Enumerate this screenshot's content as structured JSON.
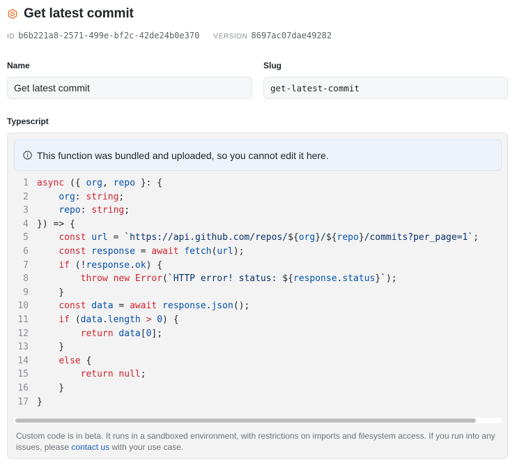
{
  "header": {
    "title": "Get latest commit",
    "icon": "function-icon",
    "accent": "#e8772e"
  },
  "meta": {
    "id_key": "ID",
    "id_value": "b6b221a8-2571-499e-bf2c-42de24b0e370",
    "version_key": "VERSION",
    "version_value": "8697ac07dae49282"
  },
  "form": {
    "name_label": "Name",
    "name_value": "Get latest commit",
    "slug_label": "Slug",
    "slug_value": "get-latest-commit",
    "typescript_label": "Typescript"
  },
  "banner": {
    "icon": "info-icon",
    "text": "This function was bundled and uploaded, so you cannot edit it here."
  },
  "code_lines": [
    {
      "n": "1",
      "tokens": [
        [
          "kw",
          "async"
        ],
        [
          "pun",
          " ({ "
        ],
        [
          "id",
          "org"
        ],
        [
          "pun",
          ", "
        ],
        [
          "id",
          "repo"
        ],
        [
          "pun",
          " }: {"
        ]
      ]
    },
    {
      "n": "2",
      "tokens": [
        [
          "pun",
          "    "
        ],
        [
          "id",
          "org"
        ],
        [
          "pun",
          ": "
        ],
        [
          "kw",
          "string"
        ],
        [
          "pun",
          ";"
        ]
      ]
    },
    {
      "n": "3",
      "tokens": [
        [
          "pun",
          "    "
        ],
        [
          "id",
          "repo"
        ],
        [
          "pun",
          ": "
        ],
        [
          "kw",
          "string"
        ],
        [
          "pun",
          ";"
        ]
      ]
    },
    {
      "n": "4",
      "tokens": [
        [
          "pun",
          "}) => {"
        ]
      ]
    },
    {
      "n": "5",
      "tokens": [
        [
          "pun",
          "    "
        ],
        [
          "kw",
          "const"
        ],
        [
          "pun",
          " "
        ],
        [
          "id",
          "url"
        ],
        [
          "pun",
          " = "
        ],
        [
          "str",
          "`https://api.github.com/repos/"
        ],
        [
          "pun",
          "${"
        ],
        [
          "id",
          "org"
        ],
        [
          "pun",
          "}"
        ],
        [
          "str",
          "/"
        ],
        [
          "pun",
          "${"
        ],
        [
          "id",
          "repo"
        ],
        [
          "pun",
          "}"
        ],
        [
          "str",
          "/commits?per_page=1`"
        ],
        [
          "pun",
          ";"
        ]
      ]
    },
    {
      "n": "6",
      "tokens": [
        [
          "pun",
          "    "
        ],
        [
          "kw",
          "const"
        ],
        [
          "pun",
          " "
        ],
        [
          "id",
          "response"
        ],
        [
          "pun",
          " = "
        ],
        [
          "kw",
          "await"
        ],
        [
          "pun",
          " "
        ],
        [
          "id",
          "fetch"
        ],
        [
          "pun",
          "("
        ],
        [
          "id",
          "url"
        ],
        [
          "pun",
          ");"
        ]
      ]
    },
    {
      "n": "7",
      "tokens": [
        [
          "pun",
          "    "
        ],
        [
          "kw",
          "if"
        ],
        [
          "pun",
          " (!"
        ],
        [
          "id",
          "response"
        ],
        [
          "pun",
          "."
        ],
        [
          "id",
          "ok"
        ],
        [
          "pun",
          ") {"
        ]
      ]
    },
    {
      "n": "8",
      "tokens": [
        [
          "pun",
          "        "
        ],
        [
          "kw",
          "throw"
        ],
        [
          "pun",
          " "
        ],
        [
          "kw",
          "new"
        ],
        [
          "pun",
          " "
        ],
        [
          "kw",
          "Error"
        ],
        [
          "pun",
          "("
        ],
        [
          "str",
          "`HTTP error! status: "
        ],
        [
          "pun",
          "${"
        ],
        [
          "id",
          "response"
        ],
        [
          "pun",
          "."
        ],
        [
          "id",
          "status"
        ],
        [
          "pun",
          "}"
        ],
        [
          "str",
          "`"
        ],
        [
          "pun",
          ");"
        ]
      ]
    },
    {
      "n": "9",
      "tokens": [
        [
          "pun",
          "    }"
        ]
      ]
    },
    {
      "n": "10",
      "tokens": [
        [
          "pun",
          "    "
        ],
        [
          "kw",
          "const"
        ],
        [
          "pun",
          " "
        ],
        [
          "id",
          "data"
        ],
        [
          "pun",
          " = "
        ],
        [
          "kw",
          "await"
        ],
        [
          "pun",
          " "
        ],
        [
          "id",
          "response"
        ],
        [
          "pun",
          "."
        ],
        [
          "id",
          "json"
        ],
        [
          "pun",
          "();"
        ]
      ]
    },
    {
      "n": "11",
      "tokens": [
        [
          "pun",
          "    "
        ],
        [
          "kw",
          "if"
        ],
        [
          "pun",
          " ("
        ],
        [
          "id",
          "data"
        ],
        [
          "pun",
          "."
        ],
        [
          "id",
          "length"
        ],
        [
          "pun",
          " "
        ],
        [
          "kw",
          ">"
        ],
        [
          "pun",
          " "
        ],
        [
          "num",
          "0"
        ],
        [
          "pun",
          ") {"
        ]
      ]
    },
    {
      "n": "12",
      "tokens": [
        [
          "pun",
          "        "
        ],
        [
          "kw",
          "return"
        ],
        [
          "pun",
          " "
        ],
        [
          "id",
          "data"
        ],
        [
          "pun",
          "["
        ],
        [
          "num",
          "0"
        ],
        [
          "pun",
          "];"
        ]
      ]
    },
    {
      "n": "13",
      "tokens": [
        [
          "pun",
          "    }"
        ]
      ]
    },
    {
      "n": "14",
      "tokens": [
        [
          "pun",
          "    "
        ],
        [
          "kw",
          "else"
        ],
        [
          "pun",
          " {"
        ]
      ]
    },
    {
      "n": "15",
      "tokens": [
        [
          "pun",
          "        "
        ],
        [
          "kw",
          "return"
        ],
        [
          "pun",
          " "
        ],
        [
          "kw",
          "null"
        ],
        [
          "pun",
          ";"
        ]
      ]
    },
    {
      "n": "16",
      "tokens": [
        [
          "pun",
          "    }"
        ]
      ]
    },
    {
      "n": "17",
      "tokens": [
        [
          "pun",
          "}"
        ]
      ]
    }
  ],
  "footnote": {
    "text_before": "Custom code is in beta. It runs in a sandboxed environment, with restrictions on imports and filesystem access. If you run into any issues, please ",
    "link": "contact us",
    "text_after": " with your use case."
  },
  "colors": {
    "keyword": "#cf222e",
    "identifier": "#0550ae",
    "string": "#0a3069",
    "link": "#1f5fbf",
    "banner_bg": "#eef3fb"
  }
}
